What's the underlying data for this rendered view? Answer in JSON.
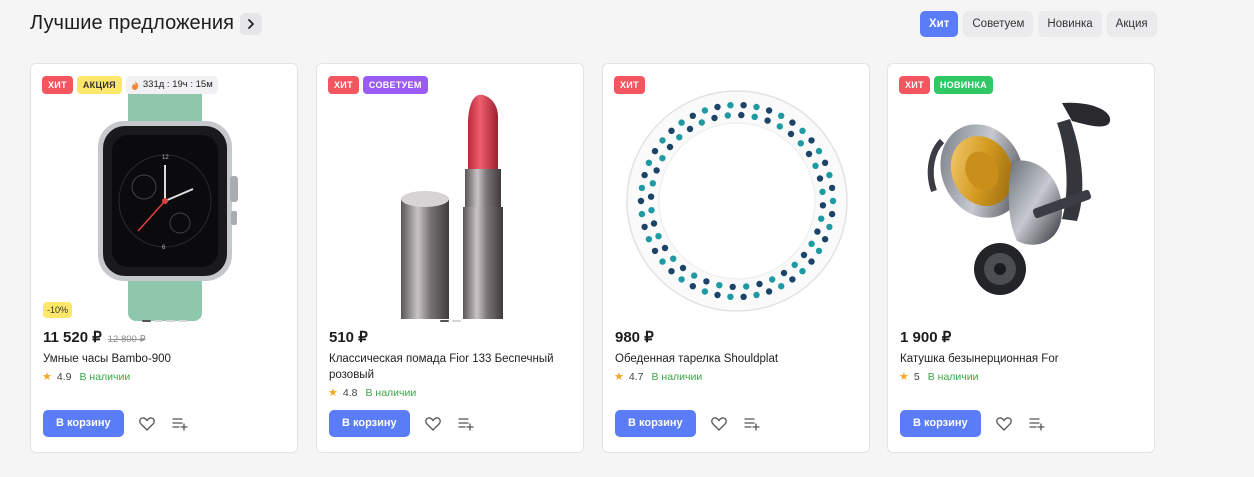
{
  "header": {
    "title": "Лучшие предложения"
  },
  "filters": [
    "Хит",
    "Советуем",
    "Новинка",
    "Акция"
  ],
  "labels": {
    "cart_button": "В корзину",
    "in_stock": "В наличии"
  },
  "products": [
    {
      "badges": [
        "Хит",
        "Акция"
      ],
      "timer": "331д : 19ч : 15м",
      "discount": "-10%",
      "price": "11 520 ₽",
      "old_price": "12 800 ₽",
      "name": "Умные часы Bambo-900",
      "rating": "4.9",
      "stock": "В наличии"
    },
    {
      "badges": [
        "Хит",
        "Советуем"
      ],
      "price": "510 ₽",
      "name": "Классическая помада Fior 133 Беспечный розовый",
      "rating": "4.8",
      "stock": "В наличии"
    },
    {
      "badges": [
        "Хит"
      ],
      "price": "980 ₽",
      "name": "Обеденная тарелка Shouldplat",
      "rating": "4.7",
      "stock": "В наличии"
    },
    {
      "badges": [
        "Хит",
        "Новинка"
      ],
      "price": "1 900 ₽",
      "name": "Катушка безынерционная For",
      "rating": "5",
      "stock": "В наличии"
    }
  ],
  "icons": {
    "title_arrow": "chevron-right-icon",
    "timer": "fire-icon",
    "rating": "star-icon",
    "favorite": "heart-icon",
    "compare": "add-to-list-icon"
  },
  "colors": {
    "accent": "#5a7cf6",
    "hit": "#f4565f",
    "sale": "#fde76a",
    "recommend": "#9b5cf5",
    "new": "#2fc865",
    "stock": "#3aa845"
  }
}
